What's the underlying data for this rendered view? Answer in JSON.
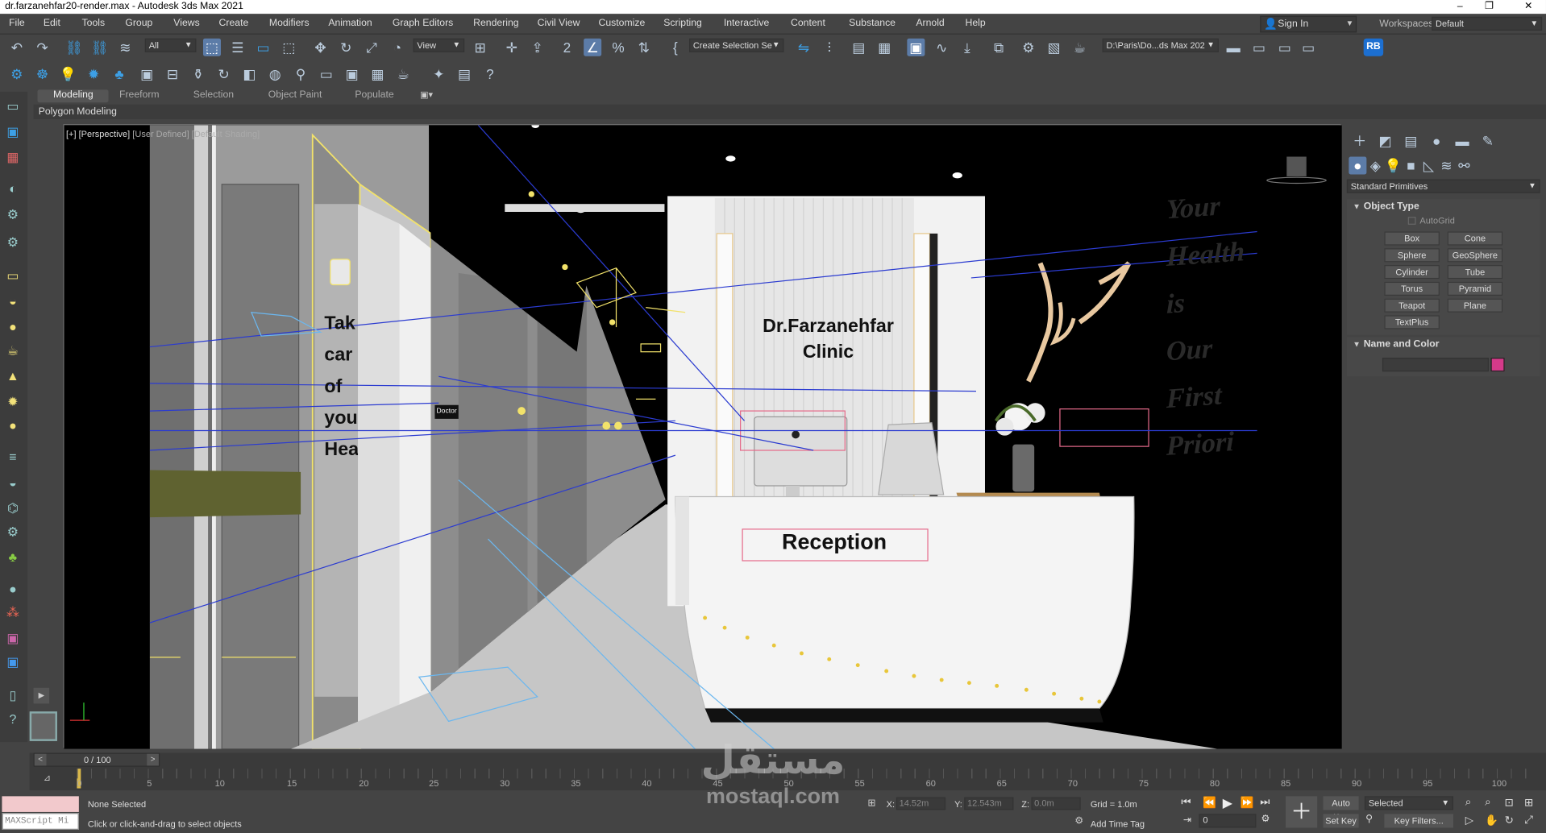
{
  "window": {
    "title": "dr.farzanehfar20-render.max - Autodesk 3ds Max 2021",
    "controls": [
      "–",
      "❐",
      "✕"
    ]
  },
  "menu": {
    "items": [
      "File",
      "Edit",
      "Tools",
      "Group",
      "Views",
      "Create",
      "Modifiers",
      "Animation",
      "Graph Editors",
      "Rendering",
      "Civil View",
      "Customize",
      "Scripting",
      "Interactive",
      "Content",
      "Substance",
      "Arnold",
      "Help"
    ],
    "sign_in": "Sign In",
    "workspaces_label": "Workspaces:",
    "workspace_value": "Default"
  },
  "toolbar": {
    "filter_value": "All",
    "ref_coord_value": "View",
    "selection_set_value": "Create Selection Se",
    "project_path": "D:\\Paris\\Do...ds Max 202",
    "rb_badge": "RB"
  },
  "ribbon": {
    "tabs": [
      "Modeling",
      "Freeform",
      "Selection",
      "Object Paint",
      "Populate"
    ],
    "active_tab": "Modeling",
    "sub_label": "Polygon Modeling"
  },
  "viewport": {
    "label_plus": "[+]",
    "label_view": "[Perspective]",
    "label_user": "[User Defined]",
    "label_shading": "[Default Shading]",
    "scene": {
      "clinic_line1": "Dr.Farzanehfar",
      "clinic_line2": "Clinic",
      "reception": "Reception",
      "wall_text": [
        "Tak",
        "car",
        "of",
        "you",
        "Hea"
      ],
      "door_sign": "Doctor",
      "slogan": [
        "Your",
        "Health",
        "is",
        "Our",
        "First",
        "Priori"
      ]
    }
  },
  "command_panel": {
    "category": "Standard Primitives",
    "object_type_title": "Object Type",
    "autogrid": "AutoGrid",
    "buttons": [
      "Box",
      "Cone",
      "Sphere",
      "GeoSphere",
      "Cylinder",
      "Tube",
      "Torus",
      "Pyramid",
      "Teapot",
      "Plane",
      "TextPlus"
    ],
    "name_color_title": "Name and Color",
    "color": "#d63a8a"
  },
  "timeline": {
    "frame_counter": "0 / 100",
    "ticks": [
      "0",
      "5",
      "10",
      "15",
      "20",
      "25",
      "30",
      "35",
      "40",
      "45",
      "50",
      "55",
      "60",
      "65",
      "70",
      "75",
      "80",
      "85",
      "90",
      "95",
      "100"
    ]
  },
  "status": {
    "maxscript": "MAXScript Mi",
    "selection": "None Selected",
    "prompt": "Click or click-and-drag to select objects",
    "x_label": "X:",
    "x_value": "14.52m",
    "y_label": "Y:",
    "y_value": "12.543m",
    "z_label": "Z:",
    "z_value": "0.0m",
    "grid": "Grid = 1.0m",
    "add_time_tag": "Add Time Tag",
    "auto_key": "Auto Key",
    "set_key": "Set Key",
    "key_mode": "Selected",
    "key_filters": "Key Filters...",
    "frame_value": "0"
  },
  "watermark": {
    "arabic": "مستقل",
    "latin": "mostaql.com"
  }
}
